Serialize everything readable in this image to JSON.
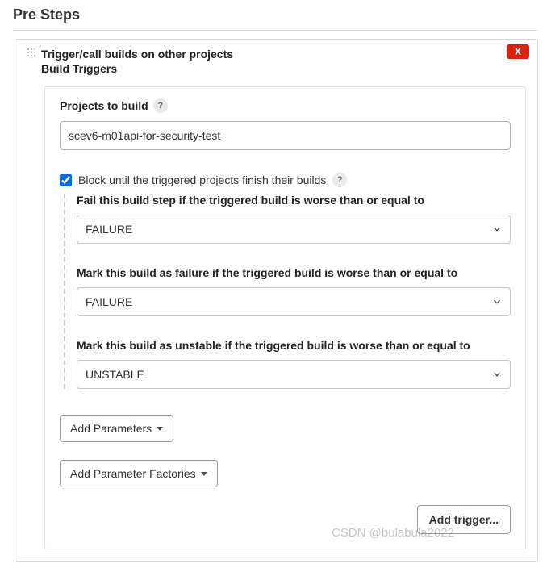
{
  "section_title": "Pre Steps",
  "delete_label": "X",
  "step": {
    "title": "Trigger/call builds on other projects",
    "subtitle": "Build Triggers"
  },
  "projects": {
    "label": "Projects to build",
    "value": "scev6-m01api-for-security-test"
  },
  "block": {
    "label": "Block until the triggered projects finish their builds",
    "checked": true
  },
  "fail_step": {
    "label": "Fail this build step if the triggered build is worse than or equal to",
    "value": "FAILURE"
  },
  "mark_failure": {
    "label": "Mark this build as failure if the triggered build is worse than or equal to",
    "value": "FAILURE"
  },
  "mark_unstable": {
    "label": "Mark this build as unstable if the triggered build is worse than or equal to",
    "value": "UNSTABLE"
  },
  "buttons": {
    "add_parameters": "Add Parameters",
    "add_parameter_factories": "Add Parameter Factories",
    "add_trigger": "Add trigger..."
  },
  "help_glyph": "?",
  "watermark": "CSDN @bulabula2022"
}
